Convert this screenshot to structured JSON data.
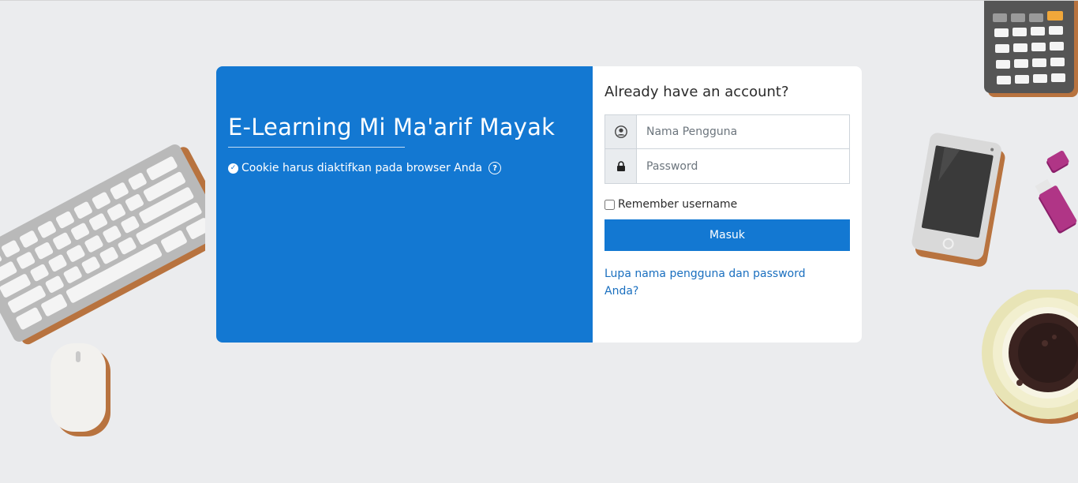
{
  "site": {
    "title": "E-Learning Mi Ma'arif Mayak",
    "cookie_notice": "Cookie harus diaktifkan pada browser Anda",
    "check_icon": "check-circle-icon",
    "help_icon": "question-circle-icon"
  },
  "login": {
    "heading": "Already have an account?",
    "username_placeholder": "Nama Pengguna",
    "password_placeholder": "Password",
    "remember_label": "Remember username",
    "remember_checked": false,
    "submit_label": "Masuk",
    "forgot_link": "Lupa nama pengguna dan password Anda?",
    "user_icon": "user-circle-icon",
    "lock_icon": "lock-icon"
  },
  "colors": {
    "background": "#ebecee",
    "brand": "#1378d2",
    "link": "#1a6fbf"
  }
}
